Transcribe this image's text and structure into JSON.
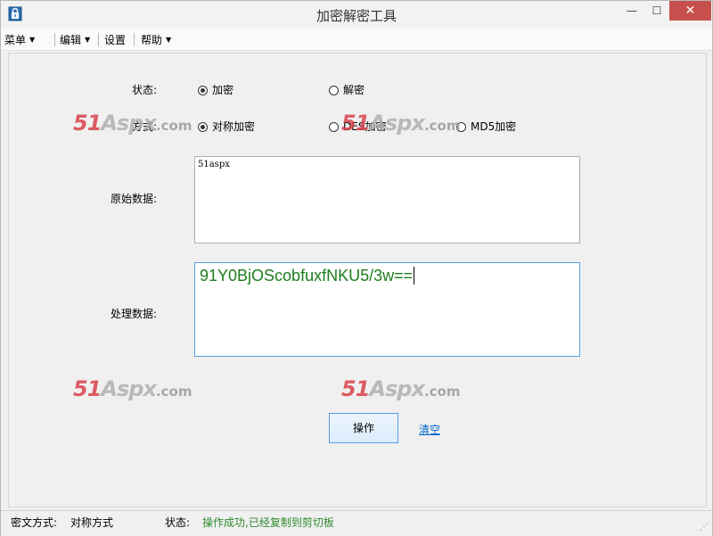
{
  "window": {
    "title": "加密解密工具",
    "icon": "lock-icon",
    "minimize": "—",
    "maximize": "☐",
    "close": "✕"
  },
  "menu": {
    "items": [
      {
        "label": "菜单",
        "has_arrow": true
      },
      {
        "label": "编辑",
        "has_arrow": true
      },
      {
        "label": "设置",
        "has_arrow": false
      },
      {
        "label": "帮助",
        "has_arrow": true
      }
    ],
    "arrow": "▼"
  },
  "form": {
    "state_label": "状态:",
    "state_options": [
      {
        "label": "加密",
        "checked": true
      },
      {
        "label": "解密",
        "checked": false
      }
    ],
    "mode_label": "方式:",
    "mode_options": [
      {
        "label": "对称加密",
        "checked": true
      },
      {
        "label": "DES加密",
        "checked": false
      },
      {
        "label": "MD5加密",
        "checked": false
      }
    ],
    "original_label": "原始数据:",
    "original_value": "51aspx",
    "result_label": "处理数据:",
    "result_value": "91Y0BjOScobfuxfNKU5/3w=="
  },
  "watermark": {
    "num": "51",
    "aspx": "Aspx",
    "com": ".com"
  },
  "actions": {
    "operate": "操作",
    "clear": "清空"
  },
  "status": {
    "cipher_label": "密文方式:",
    "cipher_value": "对称方式",
    "state_label": "状态:",
    "state_value": "操作成功,已经复制到剪切板"
  },
  "colors": {
    "result_text": "#1d7d1d",
    "status_ok": "#2e8b2e",
    "close_button": "#c7504c",
    "link": "#0066cc",
    "watermark_red": "#d9434c"
  }
}
